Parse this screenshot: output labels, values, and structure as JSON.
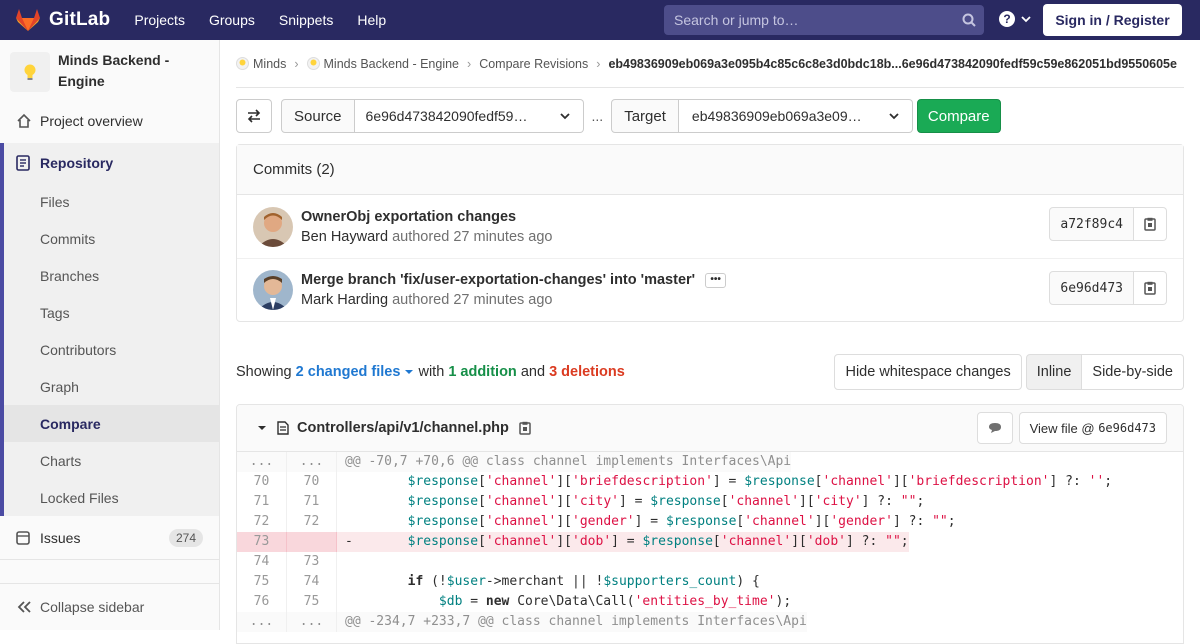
{
  "topbar": {
    "brand": "GitLab",
    "nav": [
      "Projects",
      "Groups",
      "Snippets",
      "Help"
    ],
    "search_placeholder": "Search or jump to…",
    "signin": "Sign in / Register"
  },
  "sidebar": {
    "project_name": "Minds Backend - Engine",
    "overview": "Project overview",
    "repository": "Repository",
    "repo_items": [
      "Files",
      "Commits",
      "Branches",
      "Tags",
      "Contributors",
      "Graph",
      "Compare",
      "Charts",
      "Locked Files"
    ],
    "active_item": "Compare",
    "issues": "Issues",
    "issues_count": "274",
    "collapse": "Collapse sidebar"
  },
  "breadcrumb": {
    "items": [
      "Minds",
      "Minds Backend - Engine",
      "Compare Revisions"
    ],
    "current": "eb49836909eb069a3e095b4c85c6c8e3d0bdc18b...6e96d473842090fedf59c59e862051bd9550605e"
  },
  "compare": {
    "source_label": "Source",
    "source_value": "6e96d473842090fedf59…",
    "separator": "...",
    "target_label": "Target",
    "target_value": "eb49836909eb069a3e09…",
    "button": "Compare"
  },
  "commits": {
    "header": "Commits (2)",
    "items": [
      {
        "title": "OwnerObj exportation changes",
        "author": "Ben Hayward",
        "meta": "authored 27 minutes ago",
        "sha": "a72f89c4"
      },
      {
        "title": "Merge branch 'fix/user-exportation-changes' into 'master'",
        "author": "Mark Harding",
        "meta": "authored 27 minutes ago",
        "sha": "6e96d473"
      }
    ]
  },
  "stats": {
    "showing": "Showing",
    "changed_files": "2 changed files",
    "with": "with",
    "additions": "1 addition",
    "and": "and",
    "deletions": "3 deletions",
    "hide_whitespace": "Hide whitespace changes",
    "inline": "Inline",
    "side_by_side": "Side-by-side"
  },
  "file": {
    "path": "Controllers/api/v1/channel.php",
    "view_file": "View file @",
    "view_sha": "6e96d473"
  },
  "diff": [
    {
      "type": "meta",
      "old": "...",
      "new": "...",
      "code": "@@ -70,7 +70,6 @@ class channel implements Interfaces\\Api"
    },
    {
      "type": "ctx",
      "old": "70",
      "new": "70",
      "code": "        $response['channel']['briefdescription'] = $response['channel']['briefdescription'] ?: '';"
    },
    {
      "type": "ctx",
      "old": "71",
      "new": "71",
      "code": "        $response['channel']['city'] = $response['channel']['city'] ?: \"\";"
    },
    {
      "type": "ctx",
      "old": "72",
      "new": "72",
      "code": "        $response['channel']['gender'] = $response['channel']['gender'] ?: \"\";"
    },
    {
      "type": "old",
      "old": "73",
      "new": "",
      "code": "-       $response['channel']['dob'] = $response['channel']['dob'] ?: \"\";"
    },
    {
      "type": "ctx",
      "old": "74",
      "new": "73",
      "code": ""
    },
    {
      "type": "ctx",
      "old": "75",
      "new": "74",
      "code": "        if (!$user->merchant || !$supporters_count) {"
    },
    {
      "type": "ctx",
      "old": "76",
      "new": "75",
      "code": "            $db = new Core\\Data\\Call('entities_by_time');"
    },
    {
      "type": "meta",
      "old": "...",
      "new": "...",
      "code": "@@ -234,7 +233,7 @@ class channel implements Interfaces\\Api"
    }
  ],
  "colors": {
    "topbar": "#292961",
    "compare_green": "#1aaa55",
    "link": "#1f78d1",
    "addition": "#168f48",
    "deletion": "#db3b21"
  }
}
